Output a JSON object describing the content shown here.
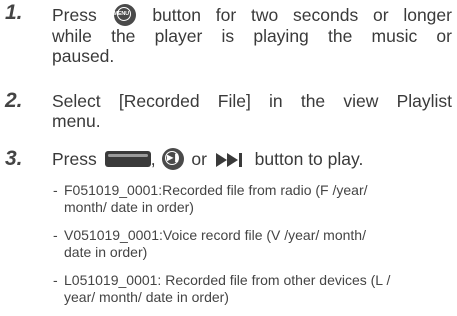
{
  "steps": [
    {
      "number": "1.",
      "line1_a": "Press",
      "menu_icon_text": "MENU",
      "line1_b": "button for two seconds or longer",
      "line2": "while the player is playing the music or",
      "line3": "paused."
    },
    {
      "number": "2.",
      "line1": "Select [Recorded File] in the view Playlist",
      "line2": "menu."
    },
    {
      "number": "3.",
      "press": "Press",
      "comma": ",",
      "or": "or",
      "tail": "button to play."
    }
  ],
  "notes": [
    {
      "dash": "-",
      "line1": "F051019_0001:Recorded file from radio (F /year/",
      "line2": "month/ date in order)"
    },
    {
      "dash": "-",
      "line1": "V051019_0001:Voice record file (V /year/ month/",
      "line2": "date in order)"
    },
    {
      "dash": "-",
      "line1": "L051019_0001: Recorded file from other devices (L /",
      "line2": "year/ month/ date in order)"
    }
  ],
  "colors": {
    "text": "#3a3a3a",
    "icon": "#4a4a4a"
  },
  "icons": [
    "menu-button-icon",
    "hold-bar-icon",
    "play-pause-button-icon",
    "fast-forward-icon"
  ]
}
